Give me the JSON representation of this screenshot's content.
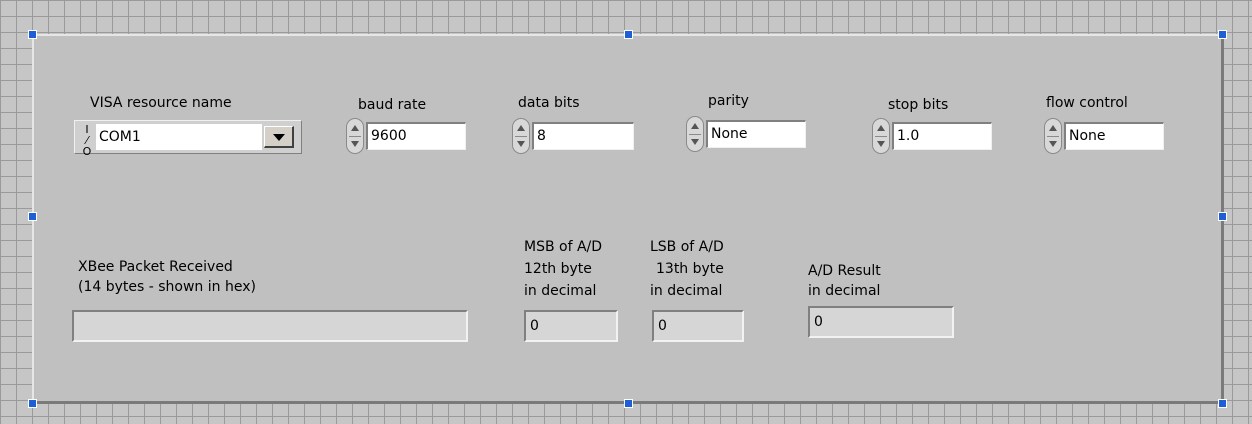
{
  "serial_config": {
    "visa_resource": {
      "label": "VISA resource name",
      "value": "COM1",
      "icon": "visa-io-icon"
    },
    "baud_rate": {
      "label": "baud rate",
      "value": "9600"
    },
    "data_bits": {
      "label": "data bits",
      "value": "8"
    },
    "parity": {
      "label": "parity",
      "value": "None"
    },
    "stop_bits": {
      "label": "stop bits",
      "value": "1.0"
    },
    "flow_control": {
      "label": "flow control",
      "value": "None"
    }
  },
  "packet": {
    "label_line1": "XBee Packet Received",
    "label_line2": "(14 bytes - shown in hex)",
    "value": ""
  },
  "msb": {
    "line1": "MSB of A/D",
    "line2": "12th byte",
    "line3": "in decimal",
    "value": "0"
  },
  "lsb": {
    "line1": "LSB of A/D",
    "line2": "13th byte",
    "line3": "in decimal",
    "value": "0"
  },
  "result": {
    "line1": "A/D Result",
    "line2": "in decimal",
    "value": "0"
  },
  "colors": {
    "selection_handle": "#1f5fd6",
    "panel": "#c0c0c0",
    "grid": "#9a9a9a"
  }
}
